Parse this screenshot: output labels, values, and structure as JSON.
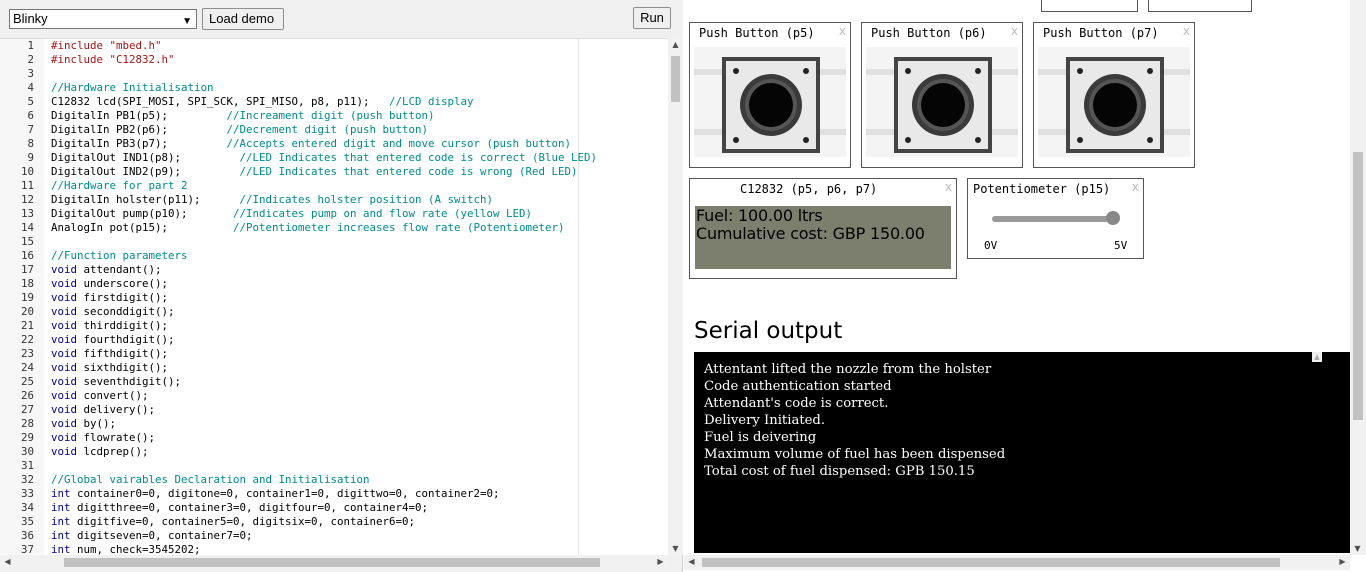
{
  "toolbar": {
    "demo_selected": "Blinky",
    "load_demo_label": "Load demo",
    "run_label": "Run"
  },
  "editor": {
    "lines": [
      [
        {
          "t": "#include \"mbed.h\"",
          "c": "str"
        }
      ],
      [
        {
          "t": "#include \"C12832.h\"",
          "c": "str"
        }
      ],
      [
        {
          "t": ""
        }
      ],
      [
        {
          "t": "//Hardware Initialisation",
          "c": "cmt"
        }
      ],
      [
        {
          "t": "C12832 lcd(SPI_MOSI, SPI_SCK, SPI_MISO, p8, p11);   "
        },
        {
          "t": "//LCD display",
          "c": "cmt"
        }
      ],
      [
        {
          "t": "DigitalIn PB1(p5);         "
        },
        {
          "t": "//Increament digit (push button)",
          "c": "cmt"
        }
      ],
      [
        {
          "t": "DigitalIn PB2(p6);         "
        },
        {
          "t": "//Decrement digit (push button)",
          "c": "cmt"
        }
      ],
      [
        {
          "t": "DigitalIn PB3(p7);         "
        },
        {
          "t": "//Accepts entered digit and move cursor (push button)",
          "c": "cmt"
        }
      ],
      [
        {
          "t": "DigitalOut IND1(p8);         "
        },
        {
          "t": "//LED Indicates that entered code is correct (Blue LED)",
          "c": "cmt"
        }
      ],
      [
        {
          "t": "DigitalOut IND2(p9);         "
        },
        {
          "t": "//LED Indicates that entered code is wrong (Red LED)",
          "c": "cmt"
        }
      ],
      [
        {
          "t": "//Hardware for part 2",
          "c": "cmt"
        }
      ],
      [
        {
          "t": "DigitalIn holster(p11);      "
        },
        {
          "t": "//Indicates holster position (A switch)",
          "c": "cmt"
        }
      ],
      [
        {
          "t": "DigitalOut pump(p10);       "
        },
        {
          "t": "//Indicates pump on and flow rate (yellow LED)",
          "c": "cmt"
        }
      ],
      [
        {
          "t": "AnalogIn pot(p15);          "
        },
        {
          "t": "//Potentiometer increases flow rate (Potentiometer)",
          "c": "cmt"
        }
      ],
      [
        {
          "t": ""
        }
      ],
      [
        {
          "t": "//Function parameters",
          "c": "cmt"
        }
      ],
      [
        {
          "t": "void",
          "c": "kw"
        },
        {
          "t": " attendant();"
        }
      ],
      [
        {
          "t": "void",
          "c": "kw"
        },
        {
          "t": " underscore();"
        }
      ],
      [
        {
          "t": "void",
          "c": "kw"
        },
        {
          "t": " firstdigit();"
        }
      ],
      [
        {
          "t": "void",
          "c": "kw"
        },
        {
          "t": " seconddigit();"
        }
      ],
      [
        {
          "t": "void",
          "c": "kw"
        },
        {
          "t": " thirddigit();"
        }
      ],
      [
        {
          "t": "void",
          "c": "kw"
        },
        {
          "t": " fourthdigit();"
        }
      ],
      [
        {
          "t": "void",
          "c": "kw"
        },
        {
          "t": " fifthdigit();"
        }
      ],
      [
        {
          "t": "void",
          "c": "kw"
        },
        {
          "t": " sixthdigit();"
        }
      ],
      [
        {
          "t": "void",
          "c": "kw"
        },
        {
          "t": " seventhdigit();"
        }
      ],
      [
        {
          "t": "void",
          "c": "kw"
        },
        {
          "t": " convert();"
        }
      ],
      [
        {
          "t": "void",
          "c": "kw"
        },
        {
          "t": " delivery();"
        }
      ],
      [
        {
          "t": "void",
          "c": "kw"
        },
        {
          "t": " by();"
        }
      ],
      [
        {
          "t": "void",
          "c": "kw"
        },
        {
          "t": " flowrate();"
        }
      ],
      [
        {
          "t": "void",
          "c": "kw"
        },
        {
          "t": " lcdprep();"
        }
      ],
      [
        {
          "t": ""
        }
      ],
      [
        {
          "t": "//Global vairables Declaration and Initialisation",
          "c": "cmt"
        }
      ],
      [
        {
          "t": "int",
          "c": "kw"
        },
        {
          "t": " container0=0, digitone=0, container1=0, digittwo=0, container2=0;"
        }
      ],
      [
        {
          "t": "int",
          "c": "kw"
        },
        {
          "t": " digitthree=0, container3=0, digitfour=0, container4=0;"
        }
      ],
      [
        {
          "t": "int",
          "c": "kw"
        },
        {
          "t": " digitfive=0, container5=0, digitsix=0, container6=0;"
        }
      ],
      [
        {
          "t": "int",
          "c": "kw"
        },
        {
          "t": " digitseven=0, container7=0;"
        }
      ],
      [
        {
          "t": "int",
          "c": "kw"
        },
        {
          "t": " num, check=3545202;"
        }
      ],
      [
        {
          "t": ""
        }
      ]
    ]
  },
  "components": {
    "pb5_title": "Push Button (p5)",
    "pb6_title": "Push Button (p6)",
    "pb7_title": "Push Button (p7)",
    "lcd_title": "C12832 (p5, p6, p7)",
    "lcd_line1": "Fuel: 100.00 ltrs",
    "lcd_line2": "Cumulative cost: GBP 150.00",
    "pot_title": "Potentiometer (p15)",
    "pot_min_label": "0V",
    "pot_max_label": "5V",
    "pot_level": 1.0,
    "close_glyph": "x"
  },
  "serial": {
    "heading": "Serial output",
    "lines": [
      "Attentant lifted the nozzle from the holster",
      "Code authentication started",
      "Attendant's code is correct.",
      "Delivery Initiated.",
      "Fuel is deivering",
      "Maximum volume of fuel has been dispensed",
      "Total cost of fuel dispensed: GPB 150.15"
    ]
  },
  "colors": {
    "lcd_background": "#7c7f6e",
    "serial_background": "#000000",
    "comment": "#008b8b",
    "keyword": "#00008b",
    "string": "#a31515"
  }
}
